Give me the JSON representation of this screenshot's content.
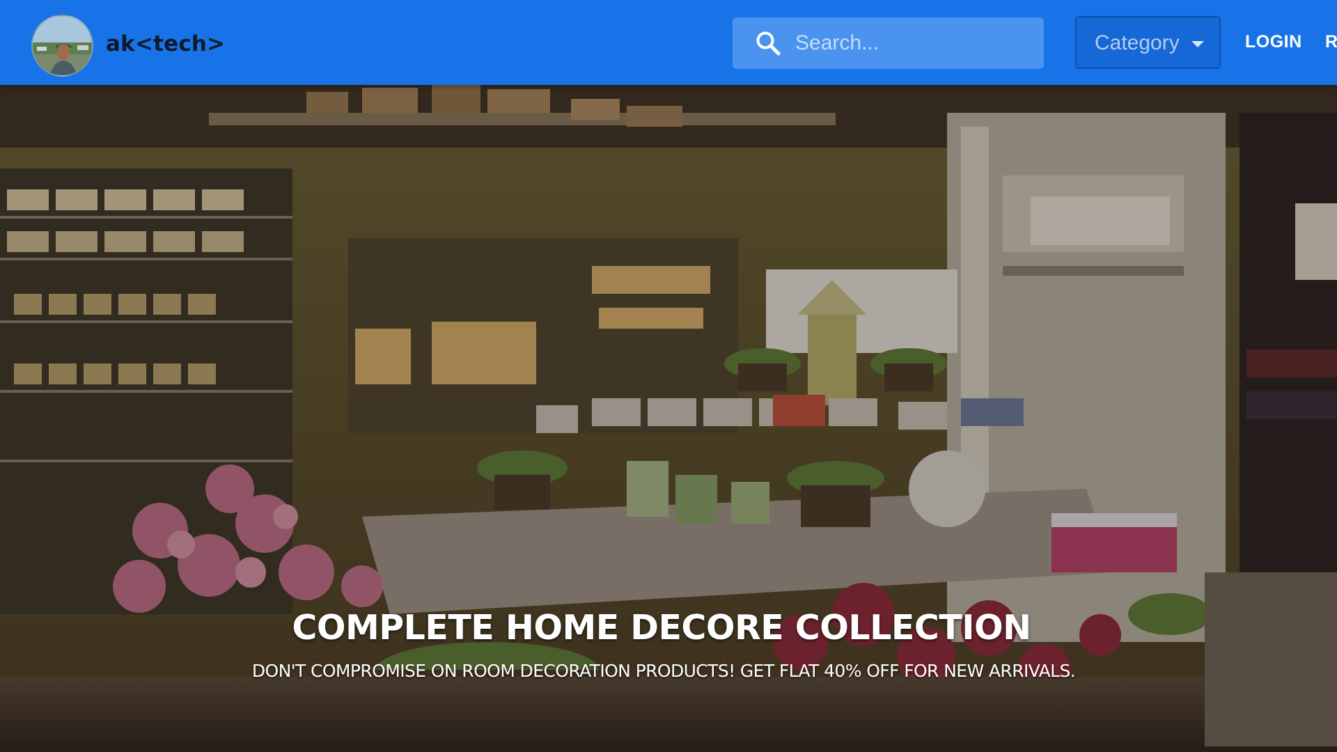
{
  "header": {
    "brand": "ak<tech>",
    "avatar_icon": "user-photo-avatar",
    "search": {
      "placeholder": "Search...",
      "value": "",
      "icon": "search-icon"
    },
    "category": {
      "label": "Category",
      "icon": "chevron-down-icon"
    },
    "login_label": "LOGIN",
    "register_label": "R"
  },
  "hero": {
    "title": "COMPLETE HOME DECORE COLLECTION",
    "subtitle": "DON'T COMPROMISE ON ROOM DECORATION PRODUCTS! GET FLAT 40% OFF FOR NEW ARRIVALS."
  },
  "colors": {
    "navbar": "#1873e8",
    "search_bg": "#4a94ef",
    "category_border": "#0f4fa6",
    "brand_text": "#0d1b2a",
    "hero_text": "#ffffff"
  }
}
